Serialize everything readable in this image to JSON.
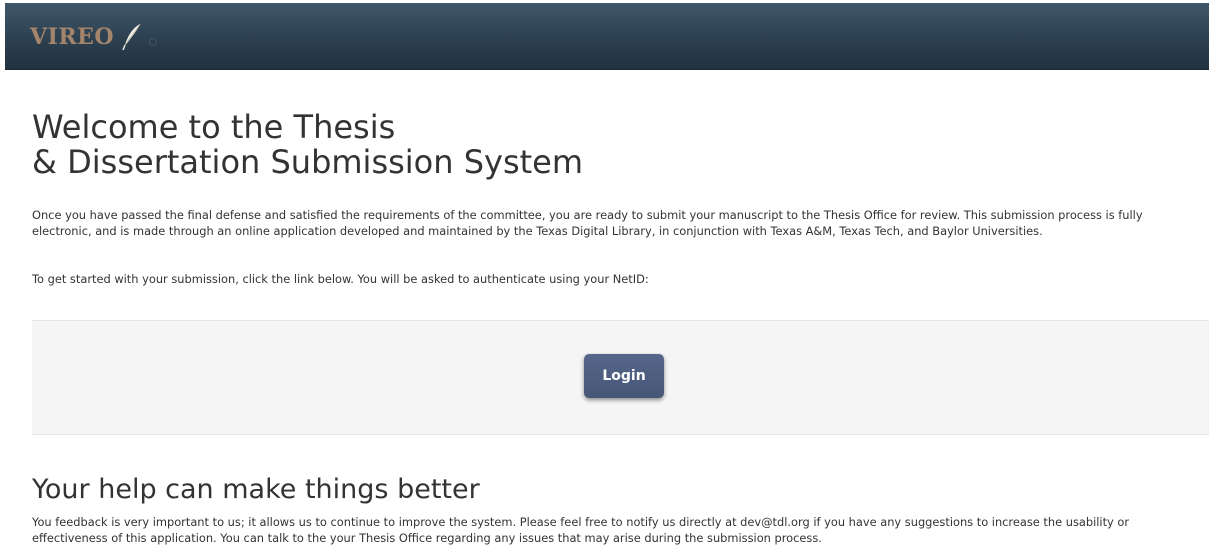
{
  "header": {
    "logo_text": "VIREO",
    "logo_icon": "feather-icon"
  },
  "welcome": {
    "title_line1": "Welcome to the Thesis",
    "title_line2": "& Dissertation Submission System",
    "intro": "Once you have passed the final defense and satisfied the requirements of the committee, you are ready to submit your manuscript to the Thesis Office for review. This submission process is fully electronic, and is made through an online application developed and maintained by the Texas Digital Library, in conjunction with Texas A&M, Texas Tech, and Baylor Universities.",
    "instruction": "To get started with your submission, click the link below. You will be asked to authenticate using your NetID:"
  },
  "login": {
    "button_label": "Login"
  },
  "help": {
    "heading": "Your help can make things better",
    "text": "You feedback is very important to us; it allows us to continue to improve the system. Please feel free to notify us directly at dev@tdl.org if you have any suggestions to increase the usability or effectiveness of this application. You can talk to the your Thesis Office regarding any issues that may arise during the submission process."
  },
  "colors": {
    "header_bg": "#2c4050",
    "logo": "#a4856c",
    "button_bg": "#4c5c7f",
    "well_bg": "#f5f5f5"
  }
}
